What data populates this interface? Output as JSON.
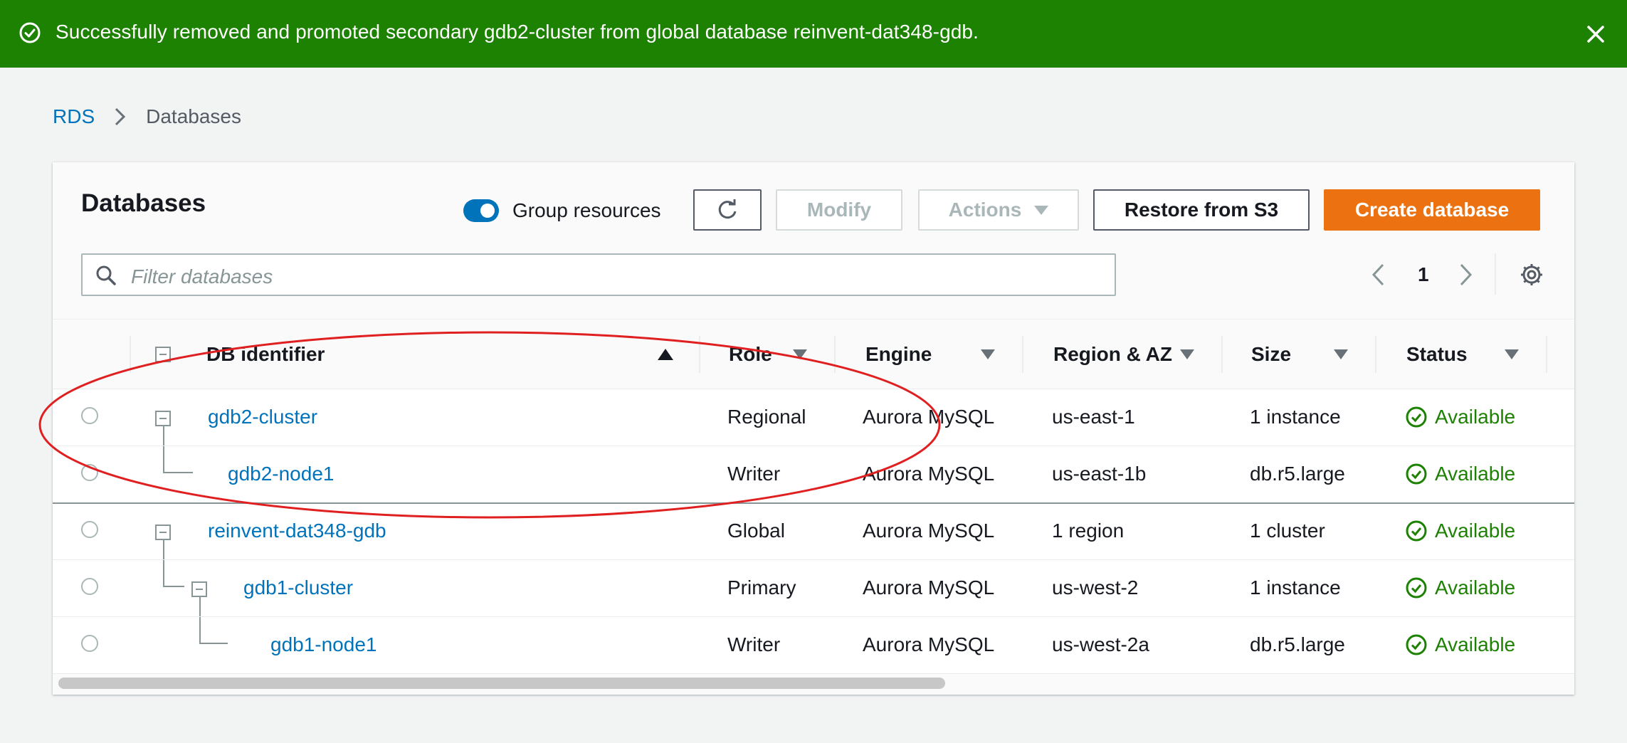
{
  "flash": {
    "message": "Successfully removed and promoted secondary gdb2-cluster from global database reinvent-dat348-gdb.",
    "color": "#1d8102"
  },
  "breadcrumb": {
    "root": "RDS",
    "current": "Databases"
  },
  "panel": {
    "title": "Databases",
    "group_resources_label": "Group resources",
    "group_resources_on": true,
    "buttons": {
      "modify": "Modify",
      "actions": "Actions",
      "restore": "Restore from S3",
      "create": "Create database"
    },
    "search_placeholder": "Filter databases",
    "page": "1"
  },
  "columns": [
    "DB identifier",
    "Role",
    "Engine",
    "Region & AZ",
    "Size",
    "Status"
  ],
  "rows": [
    {
      "id": "gdb2-cluster",
      "role": "Regional",
      "engine": "Aurora MySQL",
      "region": "us-east-1",
      "size": "1 instance",
      "status": "Available"
    },
    {
      "id": "gdb2-node1",
      "role": "Writer",
      "engine": "Aurora MySQL",
      "region": "us-east-1b",
      "size": "db.r5.large",
      "status": "Available"
    },
    {
      "id": "reinvent-dat348-gdb",
      "role": "Global",
      "engine": "Aurora MySQL",
      "region": "1 region",
      "size": "1 cluster",
      "status": "Available"
    },
    {
      "id": "gdb1-cluster",
      "role": "Primary",
      "engine": "Aurora MySQL",
      "region": "us-west-2",
      "size": "1 instance",
      "status": "Available"
    },
    {
      "id": "gdb1-node1",
      "role": "Writer",
      "engine": "Aurora MySQL",
      "region": "us-west-2a",
      "size": "db.r5.large",
      "status": "Available"
    }
  ],
  "colors": {
    "link": "#0073bb",
    "primary_button": "#ec7211",
    "available": "#1d8102",
    "annotation": "#e02020"
  },
  "icons": [
    "check-circle-icon",
    "close-icon",
    "chevron-right-icon",
    "refresh-icon",
    "search-icon",
    "chevron-left-icon",
    "gear-icon",
    "sort-down-icon",
    "sort-up-icon",
    "collapse-icon"
  ]
}
